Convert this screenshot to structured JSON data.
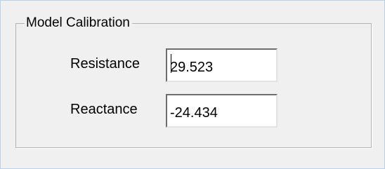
{
  "groupbox": {
    "title": "Model Calibration"
  },
  "fields": [
    {
      "label": "Resistance",
      "value": "29.523"
    },
    {
      "label": "Reactance",
      "value": "-24.434"
    }
  ]
}
